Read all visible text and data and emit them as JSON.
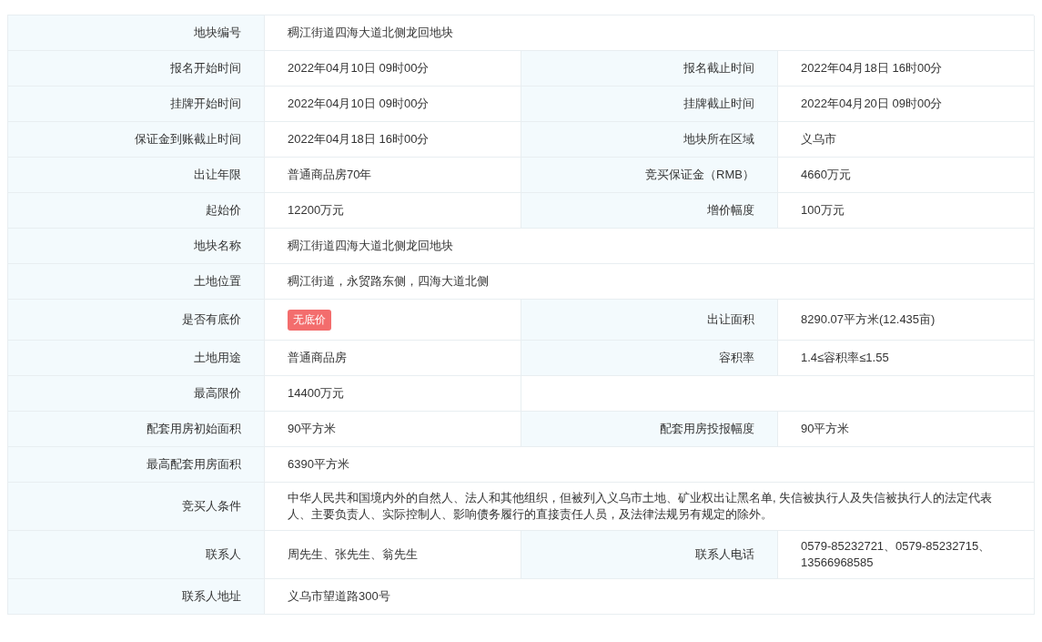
{
  "rows": [
    {
      "kind": "full",
      "cells": [
        {
          "label": "地块编号",
          "value": "稠江街道四海大道北侧龙回地块"
        }
      ]
    },
    {
      "kind": "pair",
      "cells": [
        {
          "label": "报名开始时间",
          "value": "2022年04月10日 09时00分"
        },
        {
          "label": "报名截止时间",
          "value": "2022年04月18日 16时00分"
        }
      ]
    },
    {
      "kind": "pair",
      "cells": [
        {
          "label": "挂牌开始时间",
          "value": "2022年04月10日 09时00分"
        },
        {
          "label": "挂牌截止时间",
          "value": "2022年04月20日 09时00分"
        }
      ]
    },
    {
      "kind": "pair",
      "cells": [
        {
          "label": "保证金到账截止时间",
          "value": "2022年04月18日 16时00分"
        },
        {
          "label": "地块所在区域",
          "value": "义乌市"
        }
      ]
    },
    {
      "kind": "pair",
      "cells": [
        {
          "label": "出让年限",
          "value": "普通商品房70年"
        },
        {
          "label": "竞买保证金（RMB）",
          "value": "4660万元"
        }
      ]
    },
    {
      "kind": "pair",
      "cells": [
        {
          "label": "起始价",
          "value": "12200万元"
        },
        {
          "label": "增价幅度",
          "value": "100万元"
        }
      ]
    },
    {
      "kind": "full",
      "cells": [
        {
          "label": "地块名称",
          "value": "稠江街道四海大道北侧龙回地块"
        }
      ]
    },
    {
      "kind": "full",
      "cells": [
        {
          "label": "土地位置",
          "value": "稠江街道，永贸路东侧，四海大道北侧"
        }
      ]
    },
    {
      "kind": "pair",
      "cells": [
        {
          "label": "是否有底价",
          "value": "无底价",
          "kind": "badge",
          "color": "#f36d6d"
        },
        {
          "label": "出让面积",
          "value": "8290.07平方米(12.435亩)"
        }
      ]
    },
    {
      "kind": "pair",
      "cells": [
        {
          "label": "土地用途",
          "value": "普通商品房"
        },
        {
          "label": "容积率",
          "value": "1.4≤容积率≤1.55"
        }
      ]
    },
    {
      "kind": "half",
      "cells": [
        {
          "label": "最高限价",
          "value": "14400万元"
        }
      ]
    },
    {
      "kind": "pair",
      "cells": [
        {
          "label": "配套用房初始面积",
          "value": "90平方米"
        },
        {
          "label": "配套用房投报幅度",
          "value": "90平方米"
        }
      ]
    },
    {
      "kind": "full",
      "cells": [
        {
          "label": "最高配套用房面积",
          "value": "6390平方米"
        }
      ]
    },
    {
      "kind": "full",
      "cells": [
        {
          "label": "竞买人条件",
          "value": "中华人民共和国境内外的自然人、法人和其他组织，但被列入义乌市土地、矿业权出让黑名单, 失信被执行人及失信被执行人的法定代表人、主要负责人、实际控制人、影响债务履行的直接责任人员，及法律法规另有规定的除外。"
        }
      ]
    },
    {
      "kind": "pair",
      "cells": [
        {
          "label": "联系人",
          "value": "周先生、张先生、翁先生"
        },
        {
          "label": "联系人电话",
          "value": "0579-85232721、0579-85232715、13566968585"
        }
      ]
    },
    {
      "kind": "full",
      "cells": [
        {
          "label": "联系人地址",
          "value": "义乌市望道路300号"
        }
      ]
    }
  ]
}
